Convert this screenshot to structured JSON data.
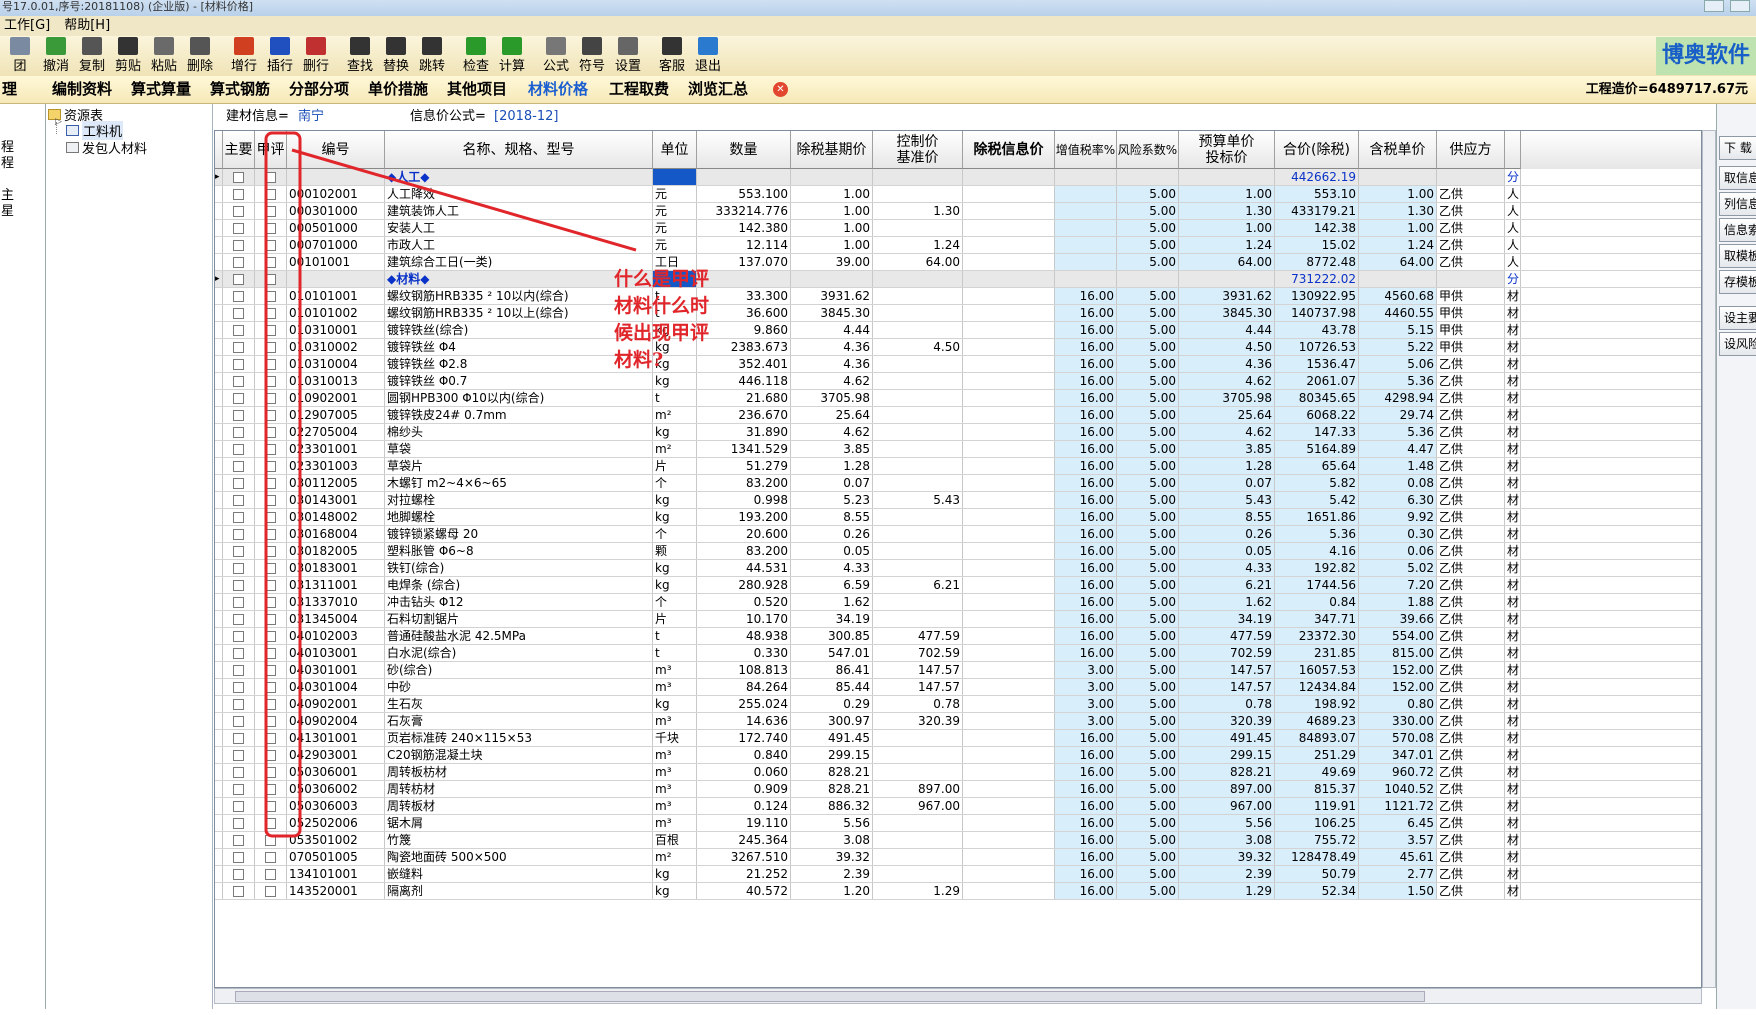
{
  "window": {
    "title": "号17.0.01,序号:20181108) (企业版) - [材料价格]"
  },
  "menu": [
    "工作[G]",
    "帮助[H]"
  ],
  "toolbar": [
    {
      "label": "团",
      "icon": "group-icon",
      "color": "#7a8aa0"
    },
    {
      "label": "撤消",
      "icon": "undo-icon",
      "color": "#3a9a3a"
    },
    {
      "label": "复制",
      "icon": "copy-icon",
      "color": "#555555"
    },
    {
      "label": "剪贴",
      "icon": "scissors-icon",
      "color": "#333333"
    },
    {
      "label": "粘贴",
      "icon": "paste-icon",
      "color": "#6a6a6a"
    },
    {
      "label": "删除",
      "icon": "delete-icon",
      "color": "#555555"
    },
    {
      "label": "增行",
      "icon": "add-row-icon",
      "color": "#d04020"
    },
    {
      "label": "插行",
      "icon": "insert-row-icon",
      "color": "#2050c0"
    },
    {
      "label": "删行",
      "icon": "delete-row-icon",
      "color": "#c03030"
    },
    {
      "label": "查找",
      "icon": "binoculars-icon",
      "color": "#333333"
    },
    {
      "label": "替换",
      "icon": "replace-icon",
      "color": "#333333"
    },
    {
      "label": "跳转",
      "icon": "jump-icon",
      "color": "#333333"
    },
    {
      "label": "检查",
      "icon": "check-icon",
      "color": "#2a9a2a"
    },
    {
      "label": "计算",
      "icon": "calculate-icon",
      "color": "#2a9a2a"
    },
    {
      "label": "公式",
      "icon": "formula-icon",
      "color": "#777777"
    },
    {
      "label": "符号",
      "icon": "symbol-icon",
      "color": "#444444"
    },
    {
      "label": "设置",
      "icon": "settings-icon",
      "color": "#666666"
    },
    {
      "label": "客服",
      "icon": "headset-icon",
      "color": "#333333"
    },
    {
      "label": "退出",
      "icon": "exit-icon",
      "color": "#2a7ad0"
    }
  ],
  "logo": {
    "text": "博奥软件"
  },
  "tabs": [
    {
      "label": "理",
      "active": false
    },
    {
      "label": "编制资料",
      "active": false
    },
    {
      "label": "算式算量",
      "active": false
    },
    {
      "label": "算式钢筋",
      "active": false
    },
    {
      "label": "分部分项",
      "active": false
    },
    {
      "label": "单价措施",
      "active": false
    },
    {
      "label": "其他项目",
      "active": false
    },
    {
      "label": "材料价格",
      "active": true
    },
    {
      "label": "工程取费",
      "active": false
    },
    {
      "label": "浏览汇总",
      "active": false
    }
  ],
  "project_total": "工程造价=6489717.67元",
  "left_strip": {
    "items": [
      "程",
      "程",
      "",
      "主",
      "星"
    ]
  },
  "tree": {
    "root": "资源表",
    "children": [
      "工料机",
      "发包人材料"
    ]
  },
  "info": {
    "material_label": "建材信息=",
    "material_value": "南宁",
    "formula_label": "信息价公式=",
    "formula_value": "[2018-12]"
  },
  "columns": {
    "main": "主要",
    "jiaping": "甲评",
    "code": "编号",
    "name": "名称、规格、型号",
    "unit": "单位",
    "qty": "数量",
    "base_price": "除税基期价",
    "control_price": "控制价",
    "base_price2": "基准价",
    "info_price": "除税信息价",
    "vat_rate": "增值税率%",
    "risk": "风险系数%",
    "budget_price": "预算单价",
    "bid_price": "投标价",
    "total": "合价(除税)",
    "tax_price": "含税单价",
    "supplier": "供应方"
  },
  "rows": [
    {
      "type": "section",
      "name": "◆人工◆",
      "total": "442662.19",
      "ext": "分"
    },
    {
      "code": "000102001",
      "name": "人工降效",
      "unit": "元",
      "qty": "553.100",
      "base": "1.00",
      "ctrl": "",
      "vat": "",
      "risk": "5.00",
      "budget": "1.00",
      "total": "553.10",
      "tax": "1.00",
      "sup": "乙供",
      "ext": "人"
    },
    {
      "code": "000301000",
      "name": "建筑装饰人工",
      "unit": "元",
      "qty": "333214.776",
      "base": "1.00",
      "ctrl": "1.30",
      "vat": "",
      "risk": "5.00",
      "budget": "1.30",
      "total": "433179.21",
      "tax": "1.30",
      "sup": "乙供",
      "ext": "人"
    },
    {
      "code": "000501000",
      "name": "安装人工",
      "unit": "元",
      "qty": "142.380",
      "base": "1.00",
      "ctrl": "",
      "vat": "",
      "risk": "5.00",
      "budget": "1.00",
      "total": "142.38",
      "tax": "1.00",
      "sup": "乙供",
      "ext": "人"
    },
    {
      "code": "000701000",
      "name": "市政人工",
      "unit": "元",
      "qty": "12.114",
      "base": "1.00",
      "ctrl": "1.24",
      "vat": "",
      "risk": "5.00",
      "budget": "1.24",
      "total": "15.02",
      "tax": "1.24",
      "sup": "乙供",
      "ext": "人"
    },
    {
      "code": "00101001",
      "name": "建筑综合工日(一类)",
      "unit": "工日",
      "qty": "137.070",
      "base": "39.00",
      "ctrl": "64.00",
      "vat": "",
      "risk": "5.00",
      "budget": "64.00",
      "total": "8772.48",
      "tax": "64.00",
      "sup": "乙供",
      "ext": "人"
    },
    {
      "type": "section",
      "name": "◆材料◆",
      "total": "731222.02",
      "ext": "分"
    },
    {
      "code": "010101001",
      "name": "螺纹钢筋HRB335 ² 10以内(综合)",
      "unit": "t",
      "qty": "33.300",
      "base": "3931.62",
      "ctrl": "",
      "vat": "16.00",
      "risk": "5.00",
      "budget": "3931.62",
      "total": "130922.95",
      "tax": "4560.68",
      "sup": "甲供",
      "ext": "材"
    },
    {
      "code": "010101002",
      "name": "螺纹钢筋HRB335 ² 10以上(综合)",
      "unit": "t",
      "qty": "36.600",
      "base": "3845.30",
      "ctrl": "",
      "vat": "16.00",
      "risk": "5.00",
      "budget": "3845.30",
      "total": "140737.98",
      "tax": "4460.55",
      "sup": "甲供",
      "ext": "材"
    },
    {
      "code": "010310001",
      "name": "镀锌铁丝(综合)",
      "unit": "kg",
      "qty": "9.860",
      "base": "4.44",
      "ctrl": "",
      "vat": "16.00",
      "risk": "5.00",
      "budget": "4.44",
      "total": "43.78",
      "tax": "5.15",
      "sup": "甲供",
      "ext": "材"
    },
    {
      "code": "010310002",
      "name": "镀锌铁丝 Φ4",
      "unit": "kg",
      "qty": "2383.673",
      "base": "4.36",
      "ctrl": "4.50",
      "vat": "16.00",
      "risk": "5.00",
      "budget": "4.50",
      "total": "10726.53",
      "tax": "5.22",
      "sup": "甲供",
      "ext": "材"
    },
    {
      "code": "010310004",
      "name": "镀锌铁丝 Φ2.8",
      "unit": "kg",
      "qty": "352.401",
      "base": "4.36",
      "ctrl": "",
      "vat": "16.00",
      "risk": "5.00",
      "budget": "4.36",
      "total": "1536.47",
      "tax": "5.06",
      "sup": "乙供",
      "ext": "材"
    },
    {
      "code": "010310013",
      "name": "镀锌铁丝 Φ0.7",
      "unit": "kg",
      "qty": "446.118",
      "base": "4.62",
      "ctrl": "",
      "vat": "16.00",
      "risk": "5.00",
      "budget": "4.62",
      "total": "2061.07",
      "tax": "5.36",
      "sup": "乙供",
      "ext": "材"
    },
    {
      "code": "010902001",
      "name": "圆钢HPB300 Φ10以内(综合)",
      "unit": "t",
      "qty": "21.680",
      "base": "3705.98",
      "ctrl": "",
      "vat": "16.00",
      "risk": "5.00",
      "budget": "3705.98",
      "total": "80345.65",
      "tax": "4298.94",
      "sup": "乙供",
      "ext": "材"
    },
    {
      "code": "012907005",
      "name": "镀锌铁皮24# 0.7mm",
      "unit": "m²",
      "qty": "236.670",
      "base": "25.64",
      "ctrl": "",
      "vat": "16.00",
      "risk": "5.00",
      "budget": "25.64",
      "total": "6068.22",
      "tax": "29.74",
      "sup": "乙供",
      "ext": "材"
    },
    {
      "code": "022705004",
      "name": "棉纱头",
      "unit": "kg",
      "qty": "31.890",
      "base": "4.62",
      "ctrl": "",
      "vat": "16.00",
      "risk": "5.00",
      "budget": "4.62",
      "total": "147.33",
      "tax": "5.36",
      "sup": "乙供",
      "ext": "材"
    },
    {
      "code": "023301001",
      "name": "草袋",
      "unit": "m²",
      "qty": "1341.529",
      "base": "3.85",
      "ctrl": "",
      "vat": "16.00",
      "risk": "5.00",
      "budget": "3.85",
      "total": "5164.89",
      "tax": "4.47",
      "sup": "乙供",
      "ext": "材"
    },
    {
      "code": "023301003",
      "name": "草袋片",
      "unit": "片",
      "qty": "51.279",
      "base": "1.28",
      "ctrl": "",
      "vat": "16.00",
      "risk": "5.00",
      "budget": "1.28",
      "total": "65.64",
      "tax": "1.48",
      "sup": "乙供",
      "ext": "材"
    },
    {
      "code": "030112005",
      "name": "木螺钉 m2~4×6~65",
      "unit": "个",
      "qty": "83.200",
      "base": "0.07",
      "ctrl": "",
      "vat": "16.00",
      "risk": "5.00",
      "budget": "0.07",
      "total": "5.82",
      "tax": "0.08",
      "sup": "乙供",
      "ext": "材"
    },
    {
      "code": "030143001",
      "name": "对拉螺栓",
      "unit": "kg",
      "qty": "0.998",
      "base": "5.23",
      "ctrl": "5.43",
      "vat": "16.00",
      "risk": "5.00",
      "budget": "5.43",
      "total": "5.42",
      "tax": "6.30",
      "sup": "乙供",
      "ext": "材"
    },
    {
      "code": "030148002",
      "name": "地脚螺栓",
      "unit": "kg",
      "qty": "193.200",
      "base": "8.55",
      "ctrl": "",
      "vat": "16.00",
      "risk": "5.00",
      "budget": "8.55",
      "total": "1651.86",
      "tax": "9.92",
      "sup": "乙供",
      "ext": "材"
    },
    {
      "code": "030168004",
      "name": "镀锌锁紧螺母 20",
      "unit": "个",
      "qty": "20.600",
      "base": "0.26",
      "ctrl": "",
      "vat": "16.00",
      "risk": "5.00",
      "budget": "0.26",
      "total": "5.36",
      "tax": "0.30",
      "sup": "乙供",
      "ext": "材"
    },
    {
      "code": "030182005",
      "name": "塑料胀管 Φ6~8",
      "unit": "颗",
      "qty": "83.200",
      "base": "0.05",
      "ctrl": "",
      "vat": "16.00",
      "risk": "5.00",
      "budget": "0.05",
      "total": "4.16",
      "tax": "0.06",
      "sup": "乙供",
      "ext": "材"
    },
    {
      "code": "030183001",
      "name": "铁钉(综合)",
      "unit": "kg",
      "qty": "44.531",
      "base": "4.33",
      "ctrl": "",
      "vat": "16.00",
      "risk": "5.00",
      "budget": "4.33",
      "total": "192.82",
      "tax": "5.02",
      "sup": "乙供",
      "ext": "材"
    },
    {
      "code": "031311001",
      "name": "电焊条 (综合)",
      "unit": "kg",
      "qty": "280.928",
      "base": "6.59",
      "ctrl": "6.21",
      "vat": "16.00",
      "risk": "5.00",
      "budget": "6.21",
      "total": "1744.56",
      "tax": "7.20",
      "sup": "乙供",
      "ext": "材"
    },
    {
      "code": "031337010",
      "name": "冲击钻头 Φ12",
      "unit": "个",
      "qty": "0.520",
      "base": "1.62",
      "ctrl": "",
      "vat": "16.00",
      "risk": "5.00",
      "budget": "1.62",
      "total": "0.84",
      "tax": "1.88",
      "sup": "乙供",
      "ext": "材"
    },
    {
      "code": "031345004",
      "name": "石料切割锯片",
      "unit": "片",
      "qty": "10.170",
      "base": "34.19",
      "ctrl": "",
      "vat": "16.00",
      "risk": "5.00",
      "budget": "34.19",
      "total": "347.71",
      "tax": "39.66",
      "sup": "乙供",
      "ext": "材"
    },
    {
      "code": "040102003",
      "name": "普通硅酸盐水泥 42.5MPa",
      "unit": "t",
      "qty": "48.938",
      "base": "300.85",
      "ctrl": "477.59",
      "vat": "16.00",
      "risk": "5.00",
      "budget": "477.59",
      "total": "23372.30",
      "tax": "554.00",
      "sup": "乙供",
      "ext": "材"
    },
    {
      "code": "040103001",
      "name": "白水泥(综合)",
      "unit": "t",
      "qty": "0.330",
      "base": "547.01",
      "ctrl": "702.59",
      "vat": "16.00",
      "risk": "5.00",
      "budget": "702.59",
      "total": "231.85",
      "tax": "815.00",
      "sup": "乙供",
      "ext": "材"
    },
    {
      "code": "040301001",
      "name": "砂(综合)",
      "unit": "m³",
      "qty": "108.813",
      "base": "86.41",
      "ctrl": "147.57",
      "vat": "3.00",
      "risk": "5.00",
      "budget": "147.57",
      "total": "16057.53",
      "tax": "152.00",
      "sup": "乙供",
      "ext": "材"
    },
    {
      "code": "040301004",
      "name": "中砂",
      "unit": "m³",
      "qty": "84.264",
      "base": "85.44",
      "ctrl": "147.57",
      "vat": "3.00",
      "risk": "5.00",
      "budget": "147.57",
      "total": "12434.84",
      "tax": "152.00",
      "sup": "乙供",
      "ext": "材"
    },
    {
      "code": "040902001",
      "name": "生石灰",
      "unit": "kg",
      "qty": "255.024",
      "base": "0.29",
      "ctrl": "0.78",
      "vat": "3.00",
      "risk": "5.00",
      "budget": "0.78",
      "total": "198.92",
      "tax": "0.80",
      "sup": "乙供",
      "ext": "材"
    },
    {
      "code": "040902004",
      "name": "石灰膏",
      "unit": "m³",
      "qty": "14.636",
      "base": "300.97",
      "ctrl": "320.39",
      "vat": "3.00",
      "risk": "5.00",
      "budget": "320.39",
      "total": "4689.23",
      "tax": "330.00",
      "sup": "乙供",
      "ext": "材"
    },
    {
      "code": "041301001",
      "name": "页岩标准砖 240×115×53",
      "unit": "千块",
      "qty": "172.740",
      "base": "491.45",
      "ctrl": "",
      "vat": "16.00",
      "risk": "5.00",
      "budget": "491.45",
      "total": "84893.07",
      "tax": "570.08",
      "sup": "乙供",
      "ext": "材"
    },
    {
      "code": "042903001",
      "name": "C20钢筋混凝土块",
      "unit": "m³",
      "qty": "0.840",
      "base": "299.15",
      "ctrl": "",
      "vat": "16.00",
      "risk": "5.00",
      "budget": "299.15",
      "total": "251.29",
      "tax": "347.01",
      "sup": "乙供",
      "ext": "材"
    },
    {
      "code": "050306001",
      "name": "周转板枋材",
      "unit": "m³",
      "qty": "0.060",
      "base": "828.21",
      "ctrl": "",
      "vat": "16.00",
      "risk": "5.00",
      "budget": "828.21",
      "total": "49.69",
      "tax": "960.72",
      "sup": "乙供",
      "ext": "材"
    },
    {
      "code": "050306002",
      "name": "周转枋材",
      "unit": "m³",
      "qty": "0.909",
      "base": "828.21",
      "ctrl": "897.00",
      "vat": "16.00",
      "risk": "5.00",
      "budget": "897.00",
      "total": "815.37",
      "tax": "1040.52",
      "sup": "乙供",
      "ext": "材"
    },
    {
      "code": "050306003",
      "name": "周转板材",
      "unit": "m³",
      "qty": "0.124",
      "base": "886.32",
      "ctrl": "967.00",
      "vat": "16.00",
      "risk": "5.00",
      "budget": "967.00",
      "total": "119.91",
      "tax": "1121.72",
      "sup": "乙供",
      "ext": "材"
    },
    {
      "code": "052502006",
      "name": "锯木屑",
      "unit": "m³",
      "qty": "19.110",
      "base": "5.56",
      "ctrl": "",
      "vat": "16.00",
      "risk": "5.00",
      "budget": "5.56",
      "total": "106.25",
      "tax": "6.45",
      "sup": "乙供",
      "ext": "材"
    },
    {
      "code": "053501002",
      "name": "竹篾",
      "unit": "百根",
      "qty": "245.364",
      "base": "3.08",
      "ctrl": "",
      "vat": "16.00",
      "risk": "5.00",
      "budget": "3.08",
      "total": "755.72",
      "tax": "3.57",
      "sup": "乙供",
      "ext": "材"
    },
    {
      "code": "070501005",
      "name": "陶瓷地面砖 500×500",
      "unit": "m²",
      "qty": "3267.510",
      "base": "39.32",
      "ctrl": "",
      "vat": "16.00",
      "risk": "5.00",
      "budget": "39.32",
      "total": "128478.49",
      "tax": "45.61",
      "sup": "乙供",
      "ext": "材"
    },
    {
      "code": "134101001",
      "name": "嵌缝料",
      "unit": "kg",
      "qty": "21.252",
      "base": "2.39",
      "ctrl": "",
      "vat": "16.00",
      "risk": "5.00",
      "budget": "2.39",
      "total": "50.79",
      "tax": "2.77",
      "sup": "乙供",
      "ext": "材"
    },
    {
      "code": "143520001",
      "name": "隔离剂",
      "unit": "kg",
      "qty": "40.572",
      "base": "1.20",
      "ctrl": "1.29",
      "vat": "16.00",
      "risk": "5.00",
      "budget": "1.29",
      "total": "52.34",
      "tax": "1.50",
      "sup": "乙供",
      "ext": "材"
    }
  ],
  "right_buttons": [
    "下 载",
    "取信息",
    "列信息",
    "信息索",
    "取模板",
    "存模板",
    "设主要",
    "设风险"
  ],
  "annotation": {
    "text": "什么是甲评材料什么时候出现甲评材料?",
    "color": "#e0262b"
  }
}
